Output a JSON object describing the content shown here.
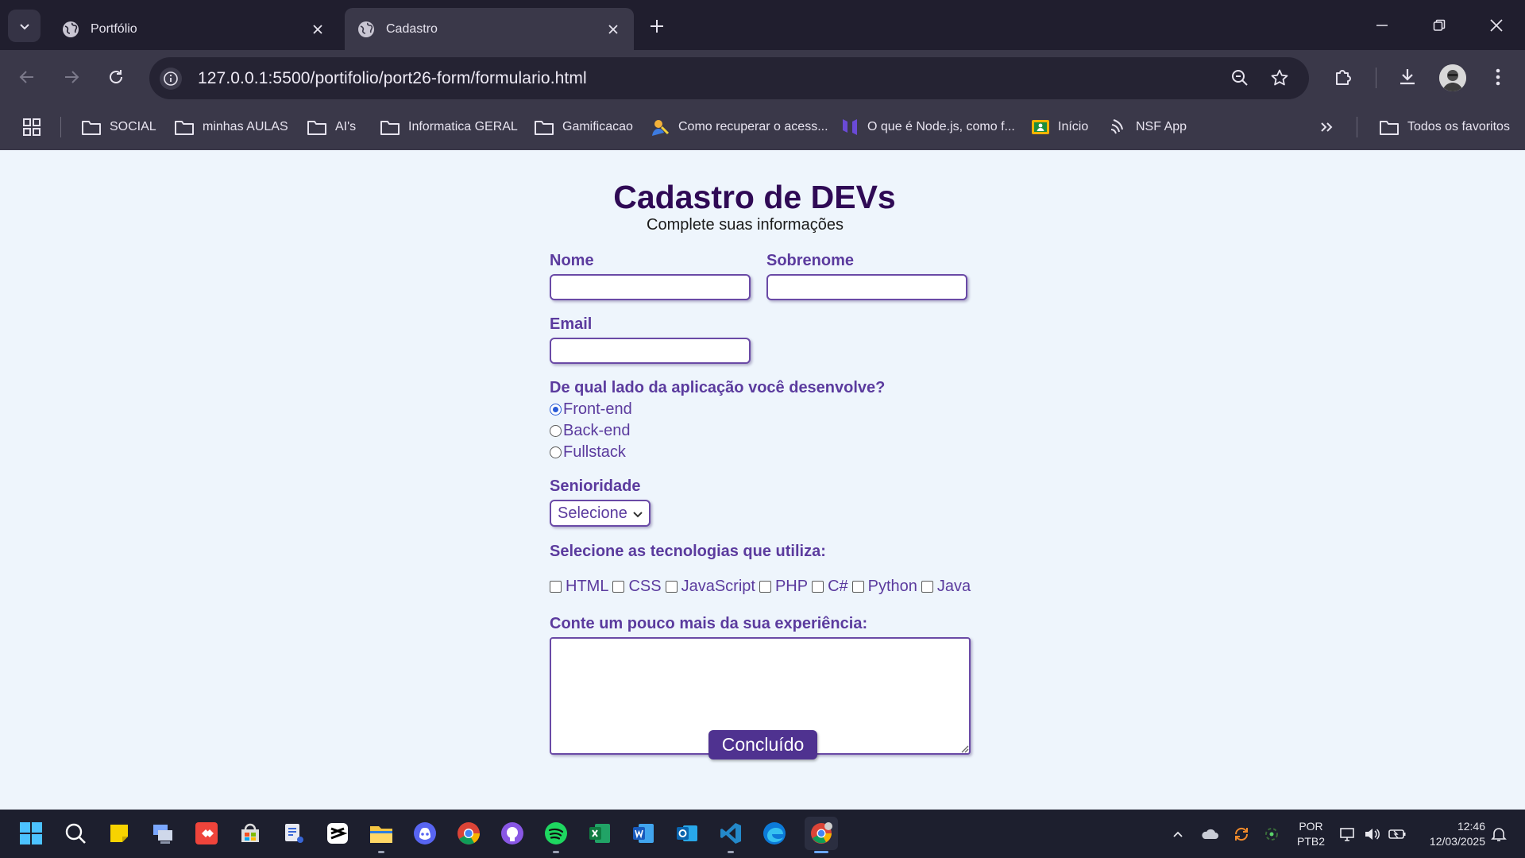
{
  "browser": {
    "tabs": [
      {
        "label": "Portfólio"
      },
      {
        "label": "Cadastro"
      }
    ],
    "url": "127.0.0.1:5500/portifolio/port26-form/formulario.html",
    "bookmarks": [
      {
        "label": "SOCIAL",
        "icon": "folder-icon"
      },
      {
        "label": "minhas AULAS",
        "icon": "folder-icon"
      },
      {
        "label": "AI's",
        "icon": "folder-icon"
      },
      {
        "label": "Informatica GERAL",
        "icon": "folder-icon"
      },
      {
        "label": "Gamificacao",
        "icon": "folder-icon"
      },
      {
        "label": "Como recuperar o acess...",
        "icon": "site-icon"
      },
      {
        "label": "O que é Node.js, como f...",
        "icon": "site-icon"
      },
      {
        "label": "Início",
        "icon": "site-icon"
      },
      {
        "label": "NSF App",
        "icon": "site-icon"
      }
    ],
    "all_bookmarks": "Todos os favoritos"
  },
  "form": {
    "title": "Cadastro de DEVs",
    "subtitle": "Complete suas informações",
    "first_name_label": "Nome",
    "first_name_value": "",
    "last_name_label": "Sobrenome",
    "last_name_value": "",
    "email_label": "Email",
    "email_value": "",
    "side_question": "De qual lado da aplicação você desenvolve?",
    "side_options": [
      {
        "label": "Front-end",
        "checked": true
      },
      {
        "label": "Back-end",
        "checked": false
      },
      {
        "label": "Fullstack",
        "checked": false
      }
    ],
    "seniority_label": "Senioridade",
    "seniority_selected": "Selecione",
    "tech_label": "Selecione as tecnologias que utiliza:",
    "techs": [
      "HTML",
      "CSS",
      "JavaScript",
      "PHP",
      "C#",
      "Python",
      "Java"
    ],
    "experience_label": "Conte um pouco mais da sua experiência:",
    "experience_value": "",
    "submit_label": "Concluído"
  },
  "taskbar": {
    "apps": [
      "windows-start-icon",
      "search-icon",
      "sticky-notes-icon",
      "network-monitor-icon",
      "anydesk-icon",
      "store-icon",
      "snipping-tool-icon",
      "capcut-icon",
      "file-explorer-icon",
      "discord-icon",
      "chrome-icon",
      "github-desktop-icon",
      "spotify-icon",
      "excel-icon",
      "word-icon",
      "outlook-icon",
      "vscode-icon",
      "edge-icon",
      "chrome-profile-icon"
    ],
    "language_line1": "POR",
    "language_line2": "PTB2",
    "time": "12:46",
    "date": "12/03/2025"
  },
  "colors": {
    "title": "#2f0a55",
    "label": "#5b3b9e",
    "button": "#4f3290",
    "page_bg": "#eef5fc",
    "chrome_bg": "#3a3849"
  }
}
